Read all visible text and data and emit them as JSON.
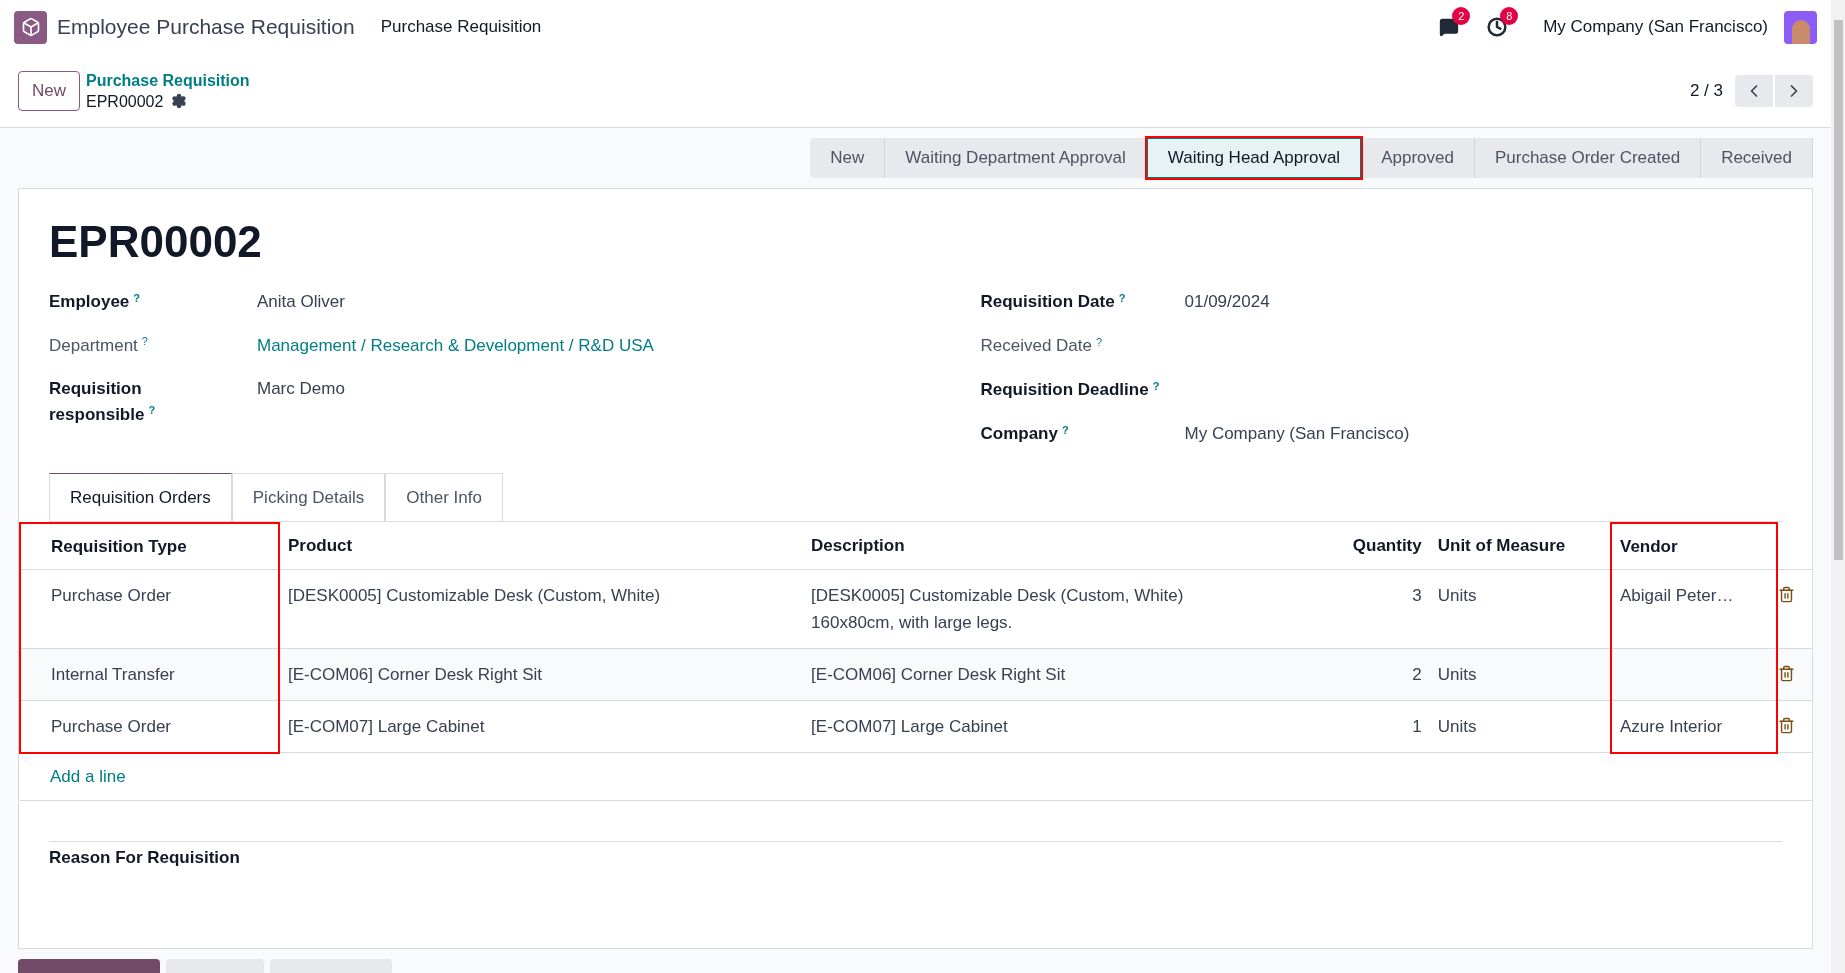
{
  "navbar": {
    "app_name": "Employee Purchase Requisition",
    "menu": [
      "Purchase Requisition"
    ],
    "messages_badge": "2",
    "activities_badge": "8",
    "company": "My Company (San Francisco)"
  },
  "control_panel": {
    "new_button": "New",
    "breadcrumb": "Purchase Requisition",
    "record": "EPR00002",
    "pager": "2 / 3"
  },
  "stages": [
    {
      "label": "New",
      "selected": false,
      "highlighted": false
    },
    {
      "label": "Waiting Department Approval",
      "selected": false,
      "highlighted": false
    },
    {
      "label": "Waiting Head Approval",
      "selected": true,
      "highlighted": true
    },
    {
      "label": "Approved",
      "selected": false,
      "highlighted": false
    },
    {
      "label": "Purchase Order Created",
      "selected": false,
      "highlighted": false
    },
    {
      "label": "Received",
      "selected": false,
      "highlighted": false
    }
  ],
  "form": {
    "title": "EPR00002",
    "left_fields": [
      {
        "label": "Employee",
        "help": "?",
        "bold": true,
        "value": "Anita Oliver",
        "link": false
      },
      {
        "label": "Department",
        "help": "?",
        "bold": false,
        "value": "Management / Research & Development / R&D USA",
        "link": true
      },
      {
        "label": "Requisition responsible",
        "help": "?",
        "bold": true,
        "value": "Marc Demo",
        "link": false
      }
    ],
    "right_fields": [
      {
        "label": "Requisition Date",
        "help": "?",
        "bold": true,
        "value": "01/09/2024"
      },
      {
        "label": "Received Date",
        "help": "?",
        "bold": false
      },
      {
        "label": "Requisition Deadline",
        "help": "?",
        "bold": true
      },
      {
        "label": "Company",
        "help": "?",
        "bold": true,
        "value": "My Company (San Francisco)"
      }
    ],
    "tabs": [
      {
        "label": "Requisition Orders",
        "selected": true
      },
      {
        "label": "Picking Details",
        "selected": false
      },
      {
        "label": "Other Info",
        "selected": false
      }
    ],
    "table": {
      "columns": [
        {
          "label": "Requisition Type",
          "highlighted": true
        },
        {
          "label": "Product",
          "highlighted": false
        },
        {
          "label": "Description",
          "highlighted": false
        },
        {
          "label": "Quantity",
          "highlighted": false
        },
        {
          "label": "Unit of Measure",
          "highlighted": false
        },
        {
          "label": "Vendor",
          "highlighted": true
        }
      ],
      "rows": [
        {
          "cells": [
            "Purchase Order",
            "[DESK0005] Customizable Desk (Custom, White)",
            "[DESK0005] Customizable Desk (Custom, White)\n160x80cm, with large legs.",
            "3",
            "Units",
            "Abigail Peter…"
          ]
        },
        {
          "cells": [
            "Internal Transfer",
            "[E-COM06] Corner Desk Right Sit",
            "[E-COM06] Corner Desk Right Sit",
            "2",
            "Units",
            null
          ]
        },
        {
          "cells": [
            "Purchase Order",
            "[E-COM07] Large Cabinet",
            "[E-COM07] Large Cabinet",
            "1",
            "Units",
            "Azure Interior"
          ]
        }
      ],
      "add_line": "Add a line"
    },
    "reason_label": "Reason For Requisition"
  }
}
